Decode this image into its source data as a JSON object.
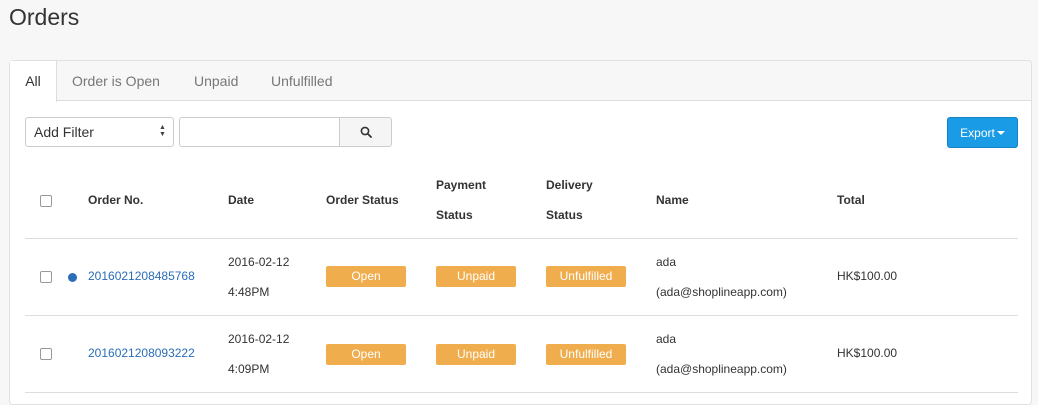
{
  "page_title": "Orders",
  "tabs": [
    {
      "label": "All",
      "active": true
    },
    {
      "label": "Order is Open"
    },
    {
      "label": "Unpaid"
    },
    {
      "label": "Unfulfilled"
    }
  ],
  "filter": {
    "selected": "Add Filter",
    "search_value": "",
    "search_icon": "search-icon"
  },
  "export_label": "Export",
  "columns": {
    "order_no": "Order No.",
    "date": "Date",
    "order_status": "Order Status",
    "payment_status_1": "Payment",
    "payment_status_2": "Status",
    "delivery_status_1": "Delivery",
    "delivery_status_2": "Status",
    "name": "Name",
    "total": "Total"
  },
  "rows": [
    {
      "order_no": "2016021208485768",
      "unread": true,
      "date": "2016-02-12",
      "time": "4:48PM",
      "order_status": "Open",
      "payment_status": "Unpaid",
      "delivery_status": "Unfulfilled",
      "name": "ada",
      "email": "(ada@shoplineapp.com)",
      "total": "HK$100.00"
    },
    {
      "order_no": "2016021208093222",
      "unread": false,
      "date": "2016-02-12",
      "time": "4:09PM",
      "order_status": "Open",
      "payment_status": "Unpaid",
      "delivery_status": "Unfulfilled",
      "name": "ada",
      "email": "(ada@shoplineapp.com)",
      "total": "HK$100.00"
    }
  ],
  "colors": {
    "accent": "#1a9be5",
    "badge": "#f0ad4e",
    "link": "#2a6db8"
  }
}
